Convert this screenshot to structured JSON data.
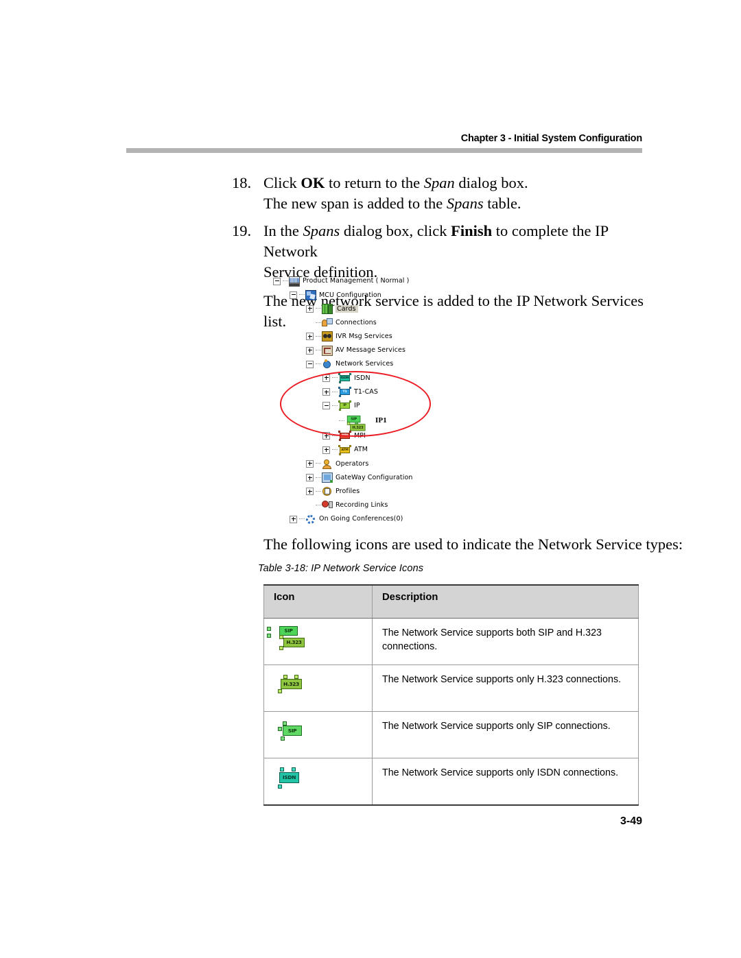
{
  "header": {
    "chapter_title": "Chapter 3 - Initial System Configuration"
  },
  "footer": {
    "page_number": "3-49"
  },
  "steps": [
    {
      "number": "18.",
      "line1_pre": "Click ",
      "line1_bold": "OK",
      "line1_mid": " to return to the ",
      "line1_italic": "Span",
      "line1_post": " dialog box.",
      "line2_pre": "The new span is added to the ",
      "line2_italic": "Spans",
      "line2_post": " table."
    },
    {
      "number": "19.",
      "line1_pre": " In the ",
      "line1_italic": "Spans",
      "line1_mid": " dialog box, click ",
      "line1_bold": "Finish",
      "line1_post": " to complete the IP Network",
      "line2": "Service definition.",
      "note": "The new network service is added to the IP Network Services list."
    }
  ],
  "tree": {
    "nodes": [
      {
        "label": "Product Management  ( Normal )",
        "icon": "server-rack-icon",
        "expander": "minus",
        "depth": 0,
        "selected": false
      },
      {
        "label": "MCU Configuration",
        "icon": "mcu-config-icon",
        "expander": "minus",
        "depth": 1,
        "selected": false
      },
      {
        "label": "Cards",
        "icon": "cards-icon",
        "expander": "plus",
        "depth": 2,
        "selected": true
      },
      {
        "label": "Connections",
        "icon": "connections-icon",
        "expander": "none",
        "depth": 2,
        "selected": false
      },
      {
        "label": "IVR Msg Services",
        "icon": "ivr-msg-icon",
        "expander": "plus",
        "depth": 2,
        "selected": false
      },
      {
        "label": "AV Message Services",
        "icon": "av-message-icon",
        "expander": "plus",
        "depth": 2,
        "selected": false
      },
      {
        "label": "Network Services",
        "icon": "network-services-icon",
        "expander": "minus",
        "depth": 2,
        "selected": false
      },
      {
        "label": "ISDN",
        "icon": "isdn-service-icon",
        "expander": "plus",
        "depth": 3,
        "selected": false
      },
      {
        "label": "T1-CAS",
        "icon": "t1cas-service-icon",
        "expander": "plus",
        "depth": 3,
        "selected": false
      },
      {
        "label": "IP",
        "icon": "ip-service-icon",
        "expander": "minus",
        "depth": 3,
        "selected": false
      },
      {
        "label": "IP1",
        "icon": "sip-h323-icon",
        "expander": "none",
        "depth": 4,
        "selected": false
      },
      {
        "label": "MPI",
        "icon": "mpi-service-icon",
        "expander": "plus",
        "depth": 3,
        "selected": false
      },
      {
        "label": "ATM",
        "icon": "atm-service-icon",
        "expander": "plus",
        "depth": 3,
        "selected": false
      },
      {
        "label": "Operators",
        "icon": "operators-icon",
        "expander": "plus",
        "depth": 2,
        "selected": false
      },
      {
        "label": "GateWay Configuration",
        "icon": "gateway-config-icon",
        "expander": "plus",
        "depth": 2,
        "selected": false
      },
      {
        "label": "Profiles",
        "icon": "profiles-icon",
        "expander": "plus",
        "depth": 2,
        "selected": false
      },
      {
        "label": "Recording Links",
        "icon": "recording-links-icon",
        "expander": "none",
        "depth": 2,
        "selected": false
      },
      {
        "label": "On Going Conferences(0)",
        "icon": "ongoing-conferences-icon",
        "expander": "plus",
        "depth": 1,
        "selected": false
      }
    ],
    "annotation": {
      "shape": "red-ellipse",
      "color": "#ec1c24"
    }
  },
  "icons_intro": "The following icons are used to indicate the Network Service types:",
  "table": {
    "caption": "Table 3-18: IP Network Service Icons",
    "headers": {
      "icon": "Icon",
      "description": "Description"
    },
    "rows": [
      {
        "icon_name": "sip-and-h323-icon",
        "icon_labels": [
          "SIP",
          "H.323"
        ],
        "description": "The Network Service supports both SIP and H.323 connections."
      },
      {
        "icon_name": "h323-only-icon",
        "icon_labels": [
          "H.323"
        ],
        "description": "The Network Service supports only H.323 connections."
      },
      {
        "icon_name": "sip-only-icon",
        "icon_labels": [
          "SIP"
        ],
        "description": "The Network Service supports only SIP connections."
      },
      {
        "icon_name": "isdn-only-icon",
        "icon_labels": [
          "ISDN"
        ],
        "description": "The Network Service supports only ISDN connections."
      }
    ]
  },
  "colors": {
    "header_rule": "#b3b3b3",
    "table_header_bg": "#d4d4d4",
    "annotation_red": "#ec1c24"
  }
}
